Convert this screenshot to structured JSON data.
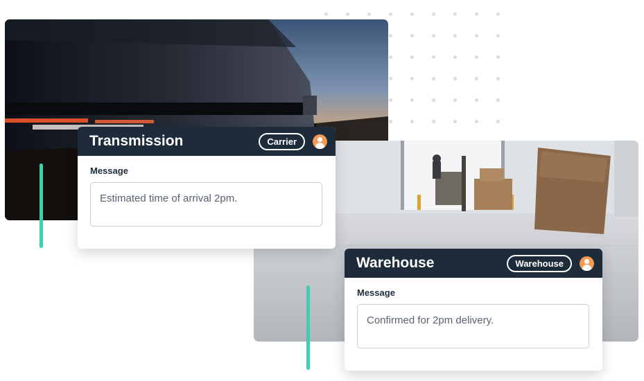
{
  "carrier_card": {
    "title": "Transmission",
    "badge": "Carrier",
    "message_label": "Message",
    "message": "Estimated time of arrival 2pm."
  },
  "warehouse_card": {
    "title": "Warehouse",
    "badge": "Warehouse",
    "message_label": "Message",
    "message": "Confirmed for 2pm delivery."
  },
  "icons": [
    "user-avatar-icon"
  ],
  "colors": {
    "card_header": "#1e2b3b",
    "accent": "#3ecfae",
    "avatar": "#f49a52"
  }
}
